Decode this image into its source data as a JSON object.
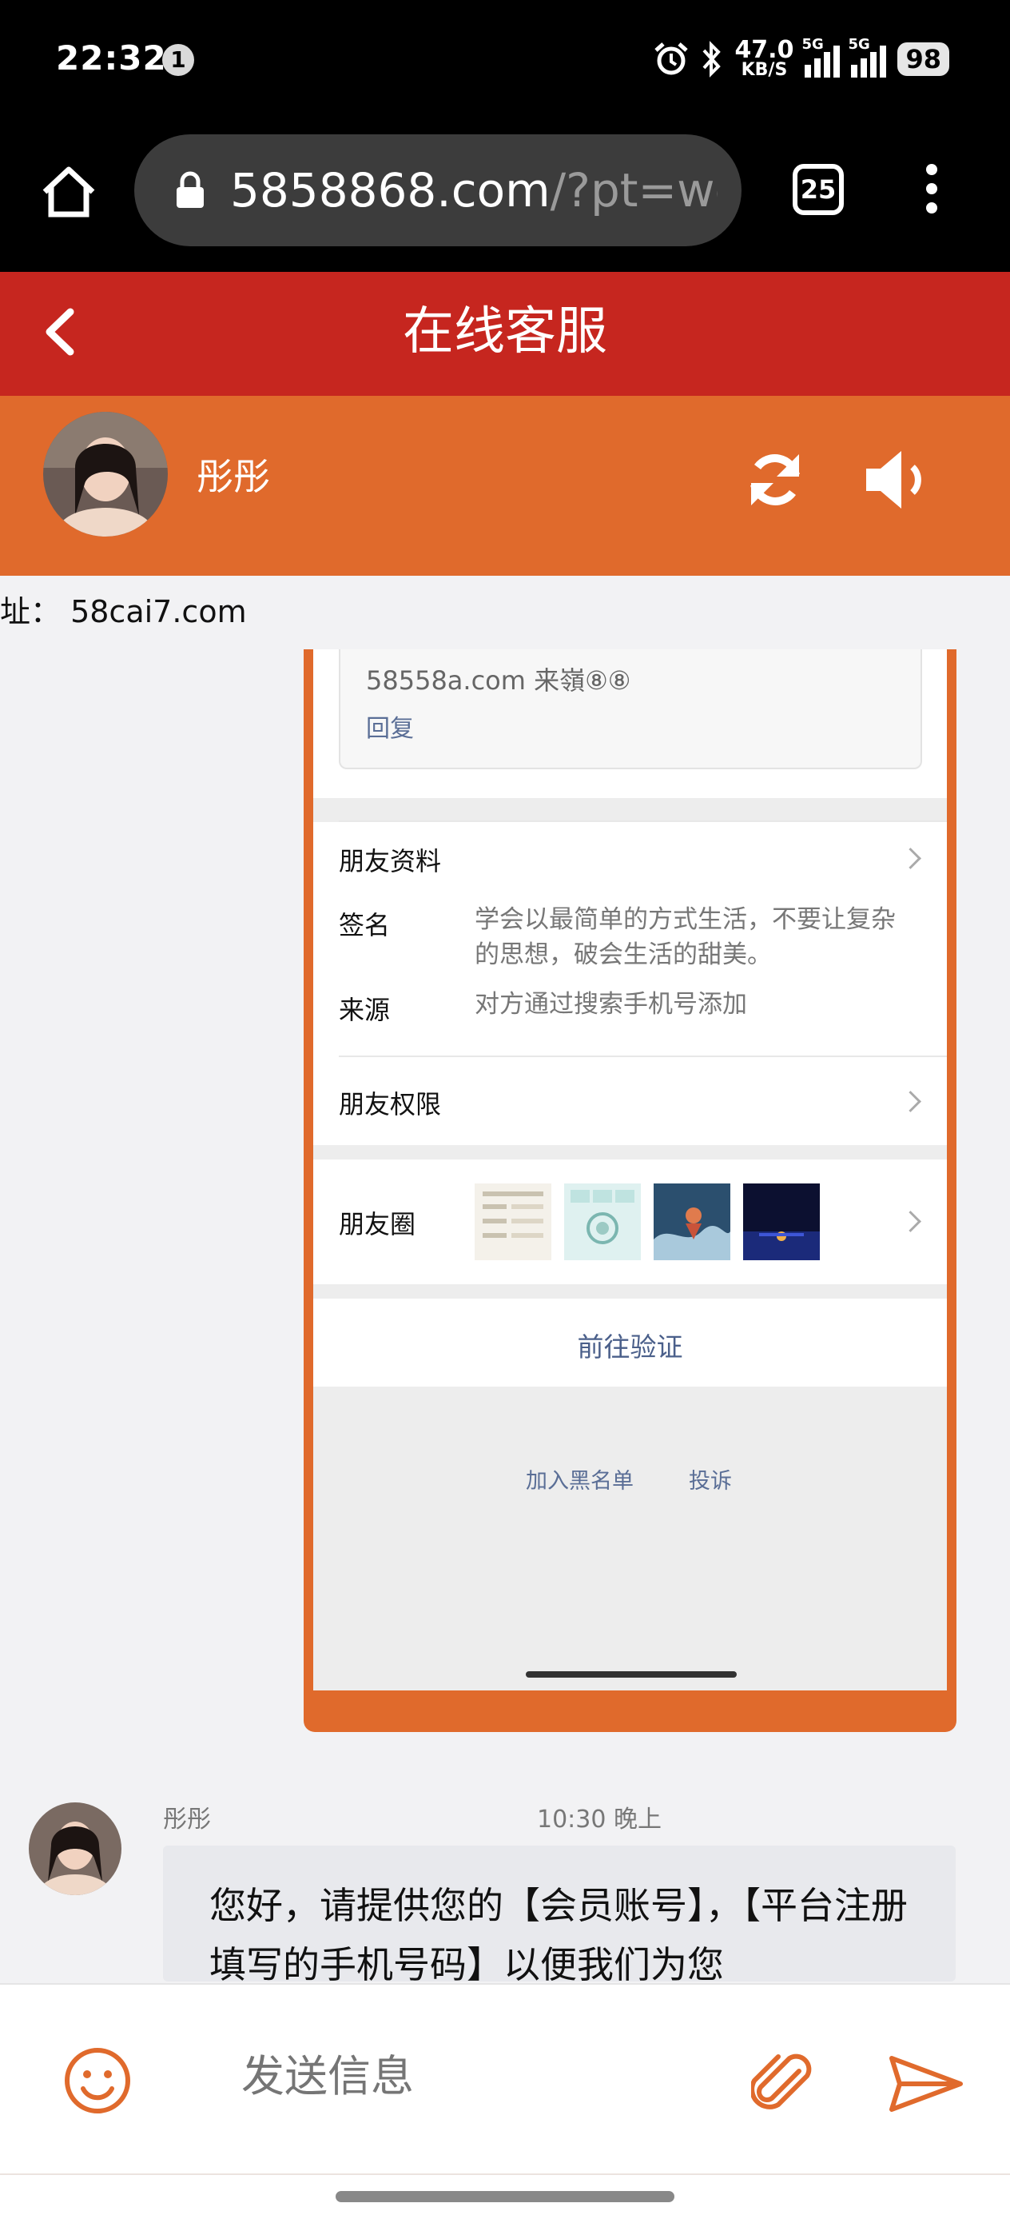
{
  "status_bar": {
    "time": "22:32",
    "notification_count": "1",
    "net_speed": "47.0",
    "net_unit": "KB/S",
    "signal1": "5G",
    "signal2": "5G",
    "battery": "98"
  },
  "browser": {
    "url_main": "5858868.com",
    "url_rest": "/?pt=we",
    "tab_count": "25"
  },
  "header": {
    "title": "在线客服",
    "agent_name": "彤彤",
    "accent_red": "#c6261f",
    "accent_orange": "#e06a2c"
  },
  "notice": {
    "text": "址：  58cai7.com"
  },
  "screenshot": {
    "reply_snippet": "58558a.com 来嶺⑧⑧",
    "reply_link": "回复",
    "friend_info": "朋友资料",
    "signature_label": "签名",
    "signature_value": "学会以最简单的方式生活，不要让复杂的思想，破会生活的甜美。",
    "source_label": "来源",
    "source_value": "对方通过搜索手机号添加",
    "permissions": "朋友权限",
    "moments": "朋友圈",
    "verify": "前往验证",
    "blacklist": "加入黑名单",
    "report": "投诉"
  },
  "message": {
    "sender": "彤彤",
    "time": "10:30 晚上",
    "text": "您好，请提供您的【会员账号】，【平台注册填写的手机号码】以便我们为您"
  },
  "input": {
    "placeholder": "发送信息"
  }
}
